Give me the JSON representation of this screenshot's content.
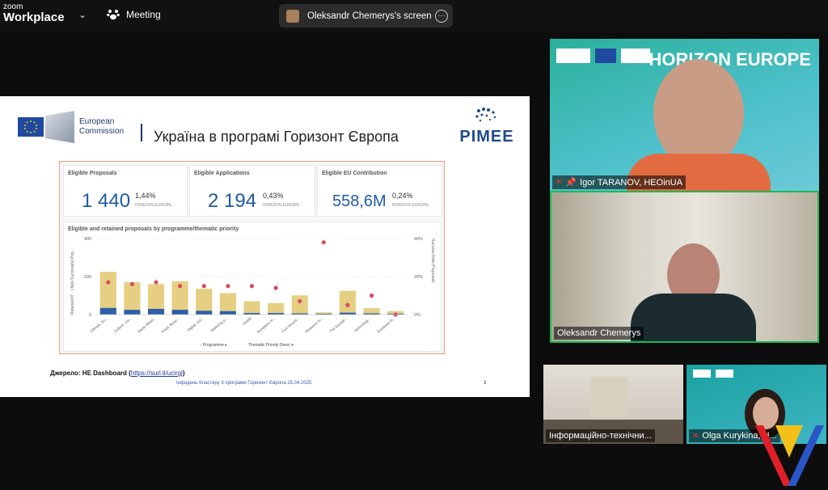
{
  "app": {
    "brand_line1": "zoom",
    "brand_line2": "Workplace",
    "meeting_label": "Meeting"
  },
  "share_pill": {
    "label": "Oleksandr Chemerys's screen"
  },
  "slide": {
    "ec_line1": "European",
    "ec_line2": "Commission",
    "title": "Україна в програмі Горизонт Європа",
    "pimee_logo": "PIMEE",
    "kpis": [
      {
        "label": "Eligible Proposals",
        "value": "1 440",
        "pct": "1,44%",
        "sub": "HORIZON EUROPE"
      },
      {
        "label": "Eligible Applications",
        "value": "2 194",
        "pct": "0,43%",
        "sub": "HORIZON EUROPE"
      },
      {
        "label": "Eligible EU Contribution",
        "value": "558,6M",
        "pct": "0,24%",
        "sub": "HORIZON EUROPE"
      }
    ],
    "source_label": "Джерело: HE Dashboard (",
    "source_link": "https://surl.li/ucirgj",
    "source_end": ")",
    "footer": "Інфодень Кластеру 3 програми Горизонт Європа 25.04.2025",
    "page": "3"
  },
  "chart_data": {
    "type": "bar",
    "title": "Eligible and retained proposals by programme/thematic priority",
    "ylabel": "Retained P... | Non-Successful Pop...",
    "y2label": "Success Rate Proposals",
    "ylim": [
      0,
      400
    ],
    "y_ticks": [
      "400",
      "200",
      "0"
    ],
    "y2_ticks": [
      "40%",
      "20%",
      "0%"
    ],
    "categories": [
      "Climate, En...",
      "Culture, cre...",
      "Marie Skłod...",
      "Food, Bioec...",
      "Digital, Ind...",
      "Widening p...",
      "Health",
      "European In...",
      "Civil Securit...",
      "Research In...",
      "The Europe...",
      "Reforming ...",
      "European R..."
    ],
    "series": [
      {
        "name": "Non-Successful",
        "values": [
          190,
          145,
          130,
          150,
          115,
          95,
          62,
          52,
          95,
          8,
          115,
          28,
          14
        ]
      },
      {
        "name": "Retained",
        "values": [
          35,
          25,
          30,
          25,
          20,
          18,
          8,
          8,
          6,
          4,
          10,
          6,
          4
        ]
      },
      {
        "name": "Success Rate",
        "values": [
          17,
          16,
          17,
          15,
          15,
          15,
          15,
          14,
          7,
          38,
          5,
          10,
          0
        ]
      }
    ],
    "bottom_controls": [
      "Programme",
      "Thematic Priority Descr"
    ],
    "colors": {
      "unsuccessful": "#e6cf82",
      "retained": "#2f5fa8",
      "rate": "#d94b62"
    }
  },
  "participants": [
    {
      "name": "Igor TARANOV, HEOinUA",
      "banner": "HORIZON EUROPE"
    },
    {
      "name": "Oleksandr Chemerys"
    },
    {
      "name": "Інформаційно-технічни..."
    },
    {
      "name": "Olga Kurykina, H..."
    }
  ],
  "tile_logos": [
    "HEOinUA"
  ]
}
